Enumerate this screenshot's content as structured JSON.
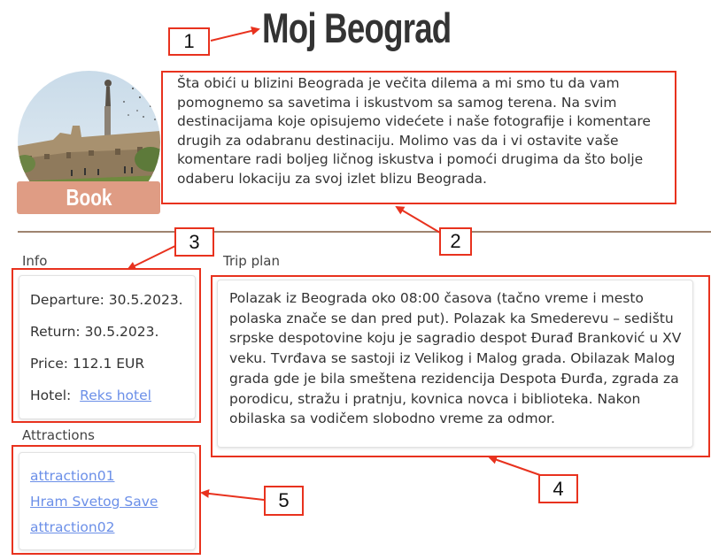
{
  "header": {
    "title": "Moj Beograd"
  },
  "book_button": {
    "label": "Book"
  },
  "intro": {
    "text": "Šta obići u blizini Beograda je večita dilema a mi smo tu da vam pomognemo sa savetima i iskustvom sa samog terena. Na svim destinacijama koje opisujemo videćete i naše fotografije i komentare drugih za odabranu destinaciju. Molimo vas da i vi ostavite vaše komentare radi boljeg ličnog iskustva i pomoći drugima da što bolje odaberu lokaciju za svoj izlet blizu Beograda."
  },
  "info": {
    "label": "Info",
    "departure": "Departure: 30.5.2023.",
    "return": "Return: 30.5.2023.",
    "price": "Price: 112.1 EUR",
    "hotel_label": "Hotel:",
    "hotel_link": "Reks hotel"
  },
  "trip_plan": {
    "label": "Trip plan",
    "text": "Polazak iz Beograda oko 08:00 časova (tačno vreme i mesto polaska znače se dan pred put). Polazak ka Smederevu – sedištu srpske despotovine koju je sagradio despot Đurađ Branković u XV veku. Tvrđava se sastoji iz Velikog i Malog grada. Obilazak Malog grada gde je bila smeštena rezidencija Despota Đurđa, zgrada za porodicu, stražu i pratnju, kovnica novca i biblioteka. Nakon obilaska sa vodičem slobodno vreme za odmor."
  },
  "attractions": {
    "label": "Attractions",
    "items": [
      "attraction01",
      "Hram Svetog Save",
      "attraction02"
    ]
  },
  "annotations": [
    "1",
    "2",
    "3",
    "4",
    "5"
  ],
  "colors": {
    "accent": "#df9c84",
    "annotation_red": "#e8321e",
    "link": "#6b8fe8",
    "divider": "#9f8470"
  }
}
